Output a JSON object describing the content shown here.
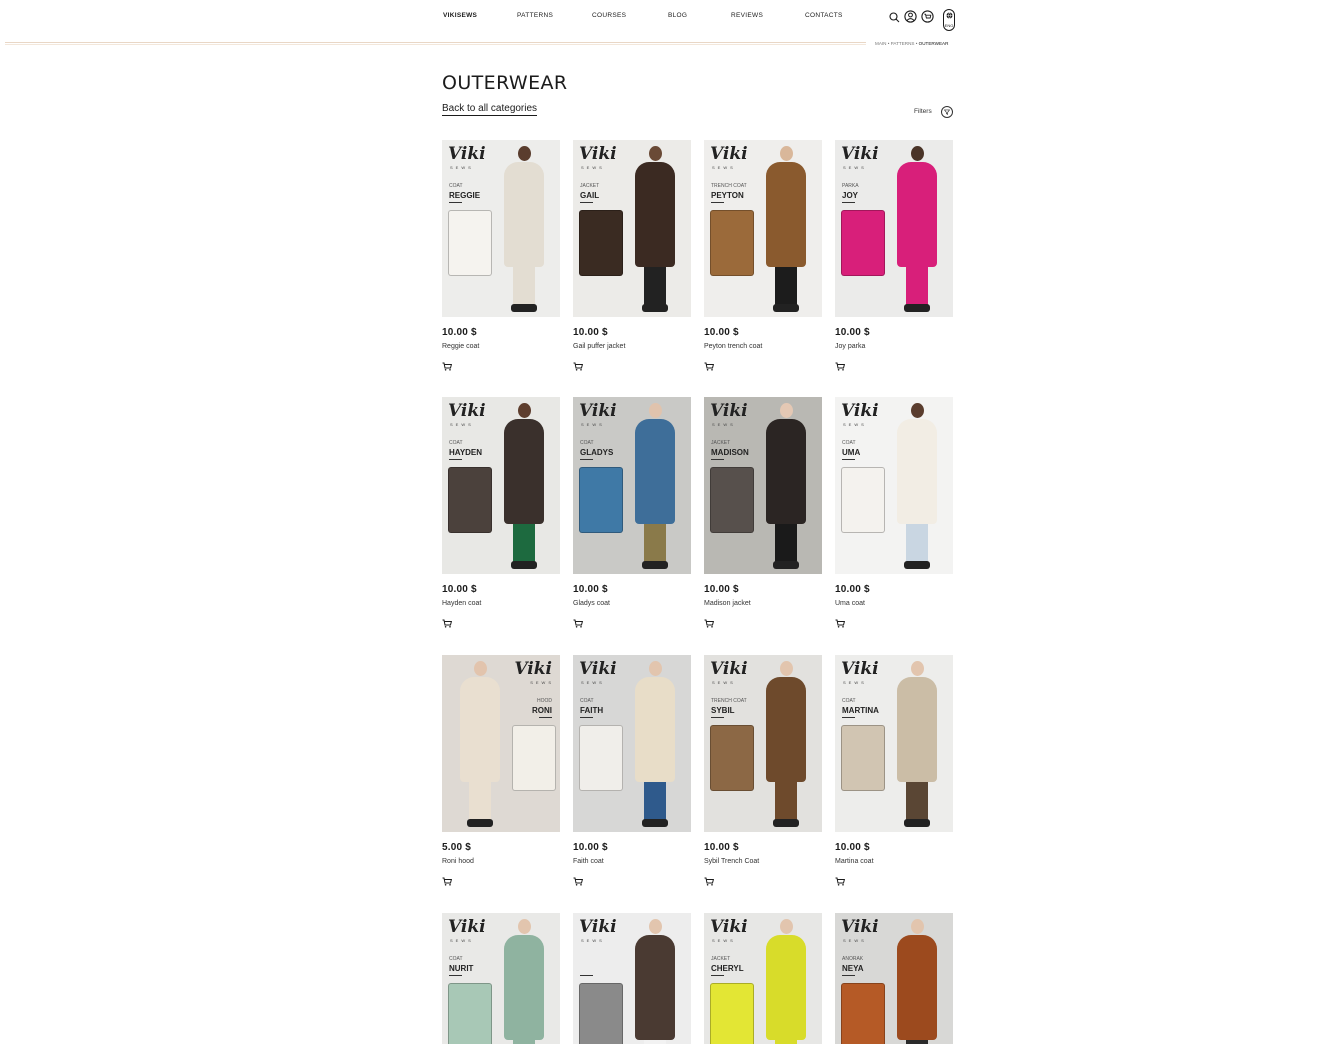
{
  "header": {
    "logo": "VIKISEWS",
    "nav": [
      "PATTERNS",
      "COURSES",
      "BLOG",
      "REVIEWS",
      "CONTACTS"
    ],
    "lang": "ENG"
  },
  "breadcrumb": {
    "main": "MAIN",
    "sep": "•",
    "patterns": "PATTERNS",
    "current": "OUTERWEAR"
  },
  "page_title": "OUTERWEAR",
  "back_link": "Back to all categories",
  "filters_label": "Filters",
  "brand": {
    "name": "Viki",
    "sub": "SEWS"
  },
  "products": [
    {
      "kind": "COAT",
      "model": "REGGIE",
      "price": "10.00 $",
      "name": "Reggie coat",
      "bg": "#ededeb",
      "coat": "#e3ddd2",
      "skin": "#5a3d2e",
      "pants": "#e3ddd2",
      "flat": "#f5f3ef"
    },
    {
      "kind": "JACKET",
      "model": "GAIL",
      "price": "10.00 $",
      "name": "Gail puffer jacket",
      "bg": "#ecebe8",
      "coat": "#3b2a22",
      "skin": "#6a4a36",
      "pants": "#222",
      "flat": "#3a2b22"
    },
    {
      "kind": "TRENCH COAT",
      "model": "PEYTON",
      "price": "10.00 $",
      "name": "Peyton trench coat",
      "bg": "#efeeec",
      "coat": "#8a5a2e",
      "skin": "#d9b79a",
      "pants": "#1c1c1c",
      "flat": "#9b6a3a"
    },
    {
      "kind": "PARKA",
      "model": "JOY",
      "price": "10.00 $",
      "name": "Joy parka",
      "bg": "#ebebea",
      "coat": "#d81f7a",
      "skin": "#4a3428",
      "pants": "#d81f7a",
      "flat": "#d81f7a"
    },
    {
      "kind": "COAT",
      "model": "HAYDEN",
      "price": "10.00 $",
      "name": "Hayden coat",
      "bg": "#e8e8e5",
      "coat": "#3a302c",
      "skin": "#5e3e2e",
      "pants": "#1d6a3f",
      "flat": "#4b413c"
    },
    {
      "kind": "COAT",
      "model": "GLADYS",
      "price": "10.00 $",
      "name": "Gladys coat",
      "bg": "#c9c9c6",
      "coat": "#3e6e99",
      "skin": "#e0c3ad",
      "pants": "#8a7a4a",
      "flat": "#3f79a6"
    },
    {
      "kind": "JACKET",
      "model": "MADISON",
      "price": "10.00 $",
      "name": "Madison jacket",
      "bg": "#b9b8b3",
      "coat": "#2b2523",
      "skin": "#e4c8b4",
      "pants": "#1a1a1a",
      "flat": "#57504c"
    },
    {
      "kind": "COAT",
      "model": "UMA",
      "price": "10.00 $",
      "name": "Uma coat",
      "bg": "#f3f3f2",
      "coat": "#f2ede4",
      "skin": "#5a3d2e",
      "pants": "#c9d6e2",
      "flat": "#f4f2ee"
    },
    {
      "kind": "HOOD",
      "model": "RONI",
      "price": "5.00 $",
      "name": "Roni hood",
      "bg": "#ded9d3",
      "coat": "#e9dfd0",
      "skin": "#e2c4ad",
      "pants": "#e9dfd0",
      "flat": "#f2efe8"
    },
    {
      "kind": "COAT",
      "model": "FAITH",
      "price": "10.00 $",
      "name": "Faith coat",
      "bg": "#d7d7d6",
      "coat": "#e8ddc8",
      "skin": "#e2c5ae",
      "pants": "#2f5a8c",
      "flat": "#f0eeea"
    },
    {
      "kind": "TRENCH COAT",
      "model": "SYBIL",
      "price": "10.00 $",
      "name": "Sybil Trench Coat",
      "bg": "#e2e1de",
      "coat": "#6e4a2c",
      "skin": "#e2c5ae",
      "pants": "#6e4a2c",
      "flat": "#8c6845"
    },
    {
      "kind": "COAT",
      "model": "MARTINA",
      "price": "10.00 $",
      "name": "Martina coat",
      "bg": "#ededeb",
      "coat": "#cbbda6",
      "skin": "#e2c5ae",
      "pants": "#5a4634",
      "flat": "#d1c5b2"
    },
    {
      "kind": "COAT",
      "model": "NURIT",
      "price": "",
      "name": "",
      "bg": "#e9e9e7",
      "coat": "#8fb3a0",
      "skin": "#e2c5ae",
      "pants": "#8fb3a0",
      "flat": "#a8c8b6"
    },
    {
      "kind": "",
      "model": "",
      "price": "",
      "name": "",
      "bg": "#ededed",
      "coat": "#4a3a32",
      "skin": "#e2c5ae",
      "pants": "#f2f2f2",
      "flat": "#8a8a8a"
    },
    {
      "kind": "JACKET",
      "model": "CHERYL",
      "price": "",
      "name": "",
      "bg": "#e7e7e5",
      "coat": "#d8dc2a",
      "skin": "#e2c5ae",
      "pants": "#d8dc2a",
      "flat": "#e3e634"
    },
    {
      "kind": "ANORAK",
      "model": "NEYA",
      "price": "",
      "name": "",
      "bg": "#d8d8d6",
      "coat": "#9c4a1e",
      "skin": "#e2c5ae",
      "pants": "#2a2a2a",
      "flat": "#b55a26"
    }
  ]
}
